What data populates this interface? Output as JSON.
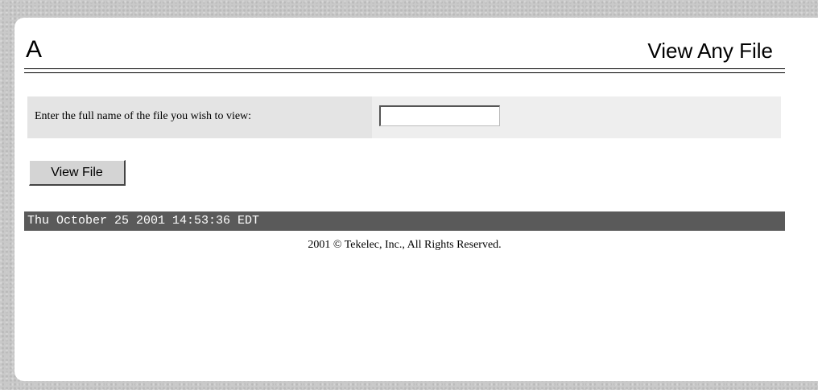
{
  "header": {
    "logo_text": "A",
    "title": "View Any File"
  },
  "form": {
    "label": "Enter the full name of the file you wish to view:",
    "file_input_value": "",
    "submit_label": "View File"
  },
  "status_bar": {
    "timestamp": "Thu October 25 2001 14:53:36 EDT"
  },
  "footer": {
    "copyright": "2001 © Tekelec, Inc., All Rights Reserved."
  },
  "colors": {
    "status_bar_bg": "#5a5a5a",
    "form_row_bg": "#eeeeee",
    "form_label_bg": "#e4e4e4",
    "button_bg": "#d4d4d4"
  }
}
